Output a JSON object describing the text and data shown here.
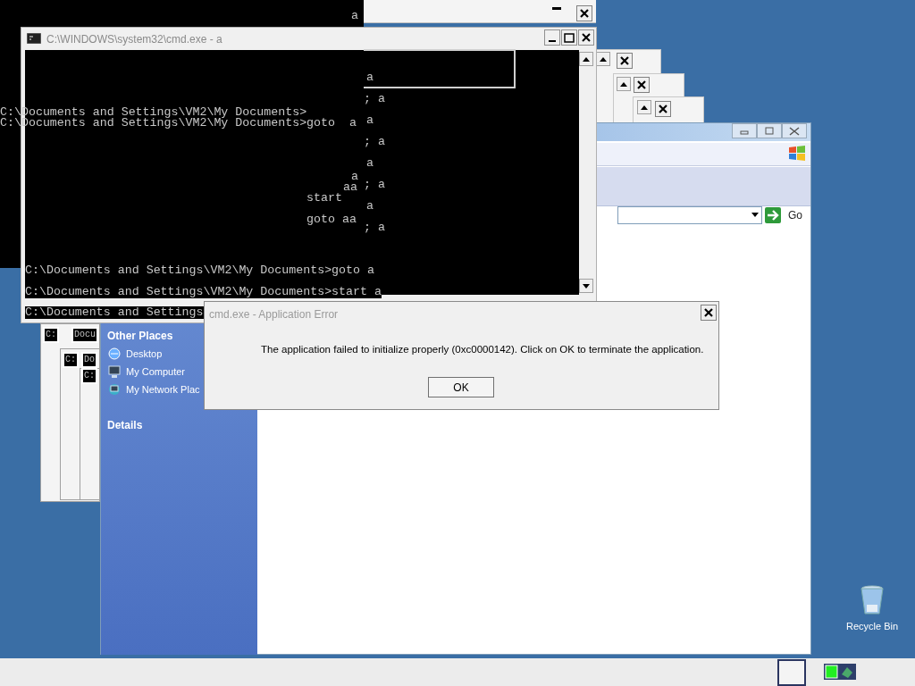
{
  "console_fragments": [
    "a",
    "a",
    "; a",
    "C:\\Documents and Settings\\VM2\\My Documents>",
    "C:\\Documents and Settings\\VM2\\My Documents>goto  a",
    "a",
    "; a",
    "a",
    "a",
    "aa",
    "; a",
    "start",
    "a",
    "goto aa",
    "; a",
    "C:\\Documents and Settings\\VM2\\My Documents>goto a",
    "C:\\Documents and Settings\\VM2\\My Documents>start a",
    "C:\\Documents and Settings"
  ],
  "cascade_titles": [
    "C:",
    "Docu",
    "C:",
    "Do",
    "C:"
  ],
  "cmd_window": {
    "title": "C:\\WINDOWS\\system32\\cmd.exe - a"
  },
  "explorer": {
    "address_go": "Go",
    "sections": [
      {
        "title": "Other Places",
        "items": [
          {
            "label": "Desktop",
            "kind": "desktop"
          },
          {
            "label": "My Computer",
            "kind": "computer"
          },
          {
            "label": "My Network Plac",
            "kind": "network"
          }
        ]
      },
      {
        "title": "Details"
      }
    ]
  },
  "error_dialog": {
    "title": "cmd.exe - Application Error",
    "message": "The application failed to initialize properly (0xc0000142). Click on OK to terminate the application.",
    "button": "OK"
  },
  "desktop_icons": [
    {
      "label": "Recycle Bin"
    }
  ]
}
